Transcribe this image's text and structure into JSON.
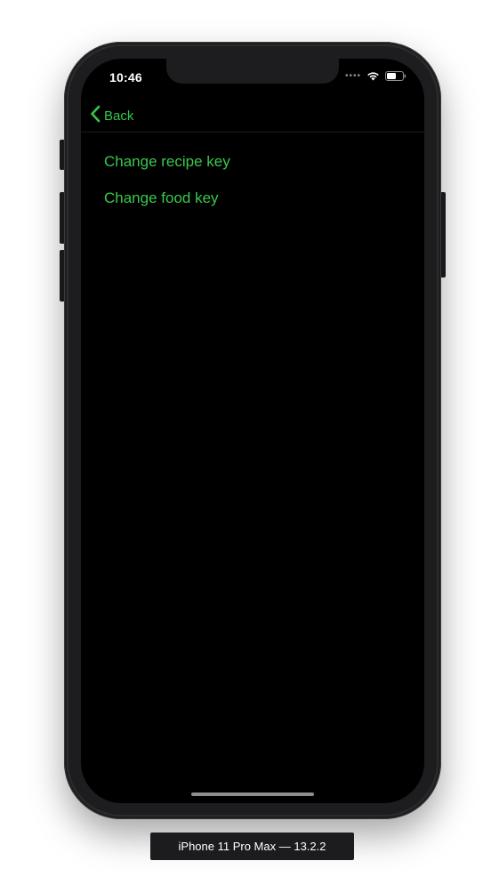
{
  "status_bar": {
    "time": "10:46",
    "signal_icon": "signal-dots-icon",
    "wifi_icon": "wifi-icon",
    "battery_icon": "battery-icon"
  },
  "nav": {
    "back_label": "Back",
    "back_icon": "chevron-left-icon"
  },
  "menu": {
    "items": [
      {
        "label": "Change recipe key"
      },
      {
        "label": "Change food key"
      }
    ]
  },
  "simulator": {
    "device_label": "iPhone 11 Pro Max — 13.2.2"
  },
  "colors": {
    "accent": "#34c84a",
    "screen_background": "#000000",
    "device_frame": "#1d1d1f"
  }
}
